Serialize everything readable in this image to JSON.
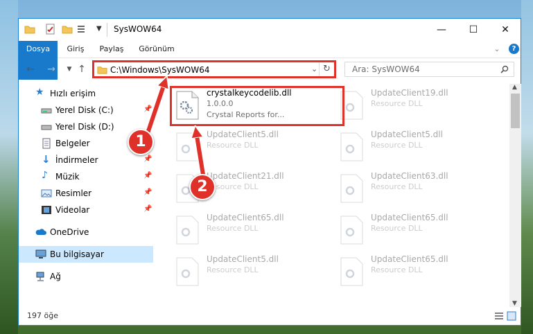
{
  "window": {
    "title": "SysWOW64",
    "minimize": "—",
    "maximize": "☐",
    "close": "✕"
  },
  "ribbon": {
    "tabs": [
      "Dosya",
      "Giriş",
      "Paylaş",
      "Görünüm"
    ],
    "expand": "⌄",
    "help": "?"
  },
  "address": {
    "path": "C:\\Windows\\SysWOW64",
    "search_placeholder": "Ara: SysWOW64"
  },
  "sidebar": {
    "items": [
      {
        "label": "Hızlı erişim",
        "icon": "star-icon"
      },
      {
        "label": "Yerel Disk (C:)",
        "icon": "drive-icon",
        "pinned": true
      },
      {
        "label": "Yerel Disk (D:)",
        "icon": "drive-icon"
      },
      {
        "label": "Belgeler",
        "icon": "documents-icon",
        "pinned": true
      },
      {
        "label": "İndirmeler",
        "icon": "download-icon",
        "pinned": true
      },
      {
        "label": "Müzik",
        "icon": "music-icon",
        "pinned": true
      },
      {
        "label": "Resimler",
        "icon": "pictures-icon",
        "pinned": true
      },
      {
        "label": "Videolar",
        "icon": "videos-icon",
        "pinned": true
      },
      {
        "label": "OneDrive",
        "icon": "cloud-icon"
      },
      {
        "label": "Bu bilgisayar",
        "icon": "computer-icon",
        "selected": true
      },
      {
        "label": "Ağ",
        "icon": "network-icon"
      }
    ]
  },
  "files": [
    {
      "name": "crystalkeycodelib.dll",
      "line2": "1.0.0.0",
      "line3": "Crystal Reports for..."
    },
    {
      "name": "UpdateClient19.dll",
      "line2": "Resource DLL"
    },
    {
      "name": "UpdateClient5.dll",
      "line2": "Resource DLL"
    },
    {
      "name": "UpdateClient5.dll",
      "line2": "Resource DLL"
    },
    {
      "name": "UpdateClient21.dll",
      "line2": "Resource DLL"
    },
    {
      "name": "UpdateClient63.dll",
      "line2": "Resource DLL"
    },
    {
      "name": "UpdateClient65.dll",
      "line2": "Resource DLL"
    },
    {
      "name": "UpdateClient65.dll",
      "line2": "Resource DLL"
    },
    {
      "name": "UpdateClient5.dll",
      "line2": "Resource DLL"
    },
    {
      "name": "UpdateClient65.dll",
      "line2": "Resource DLL"
    }
  ],
  "status": {
    "item_count": "197 öğe"
  },
  "callouts": [
    "1",
    "2"
  ],
  "colors": {
    "accent": "#1979ca",
    "highlight": "#e0302a",
    "selected": "#cce8ff"
  }
}
